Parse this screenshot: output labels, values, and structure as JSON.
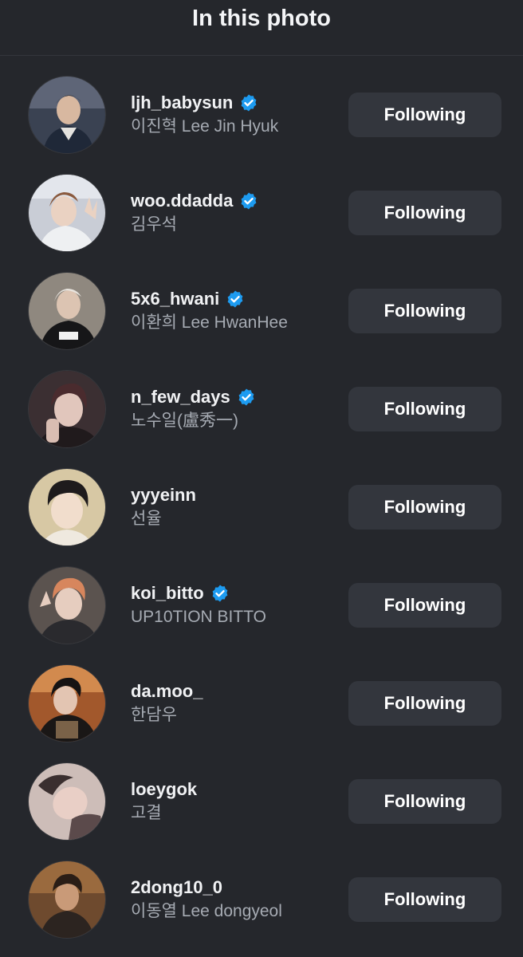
{
  "header": {
    "title": "In this photo"
  },
  "colors": {
    "background": "#25272c",
    "button": "#33363d",
    "verified": "#1d9bf0",
    "secondary_text": "#a6abb3"
  },
  "users": [
    {
      "username": "ljh_babysun",
      "verified": true,
      "full_name": "이진혁 Lee Jin Hyuk",
      "button_label": "Following"
    },
    {
      "username": "woo.ddadda",
      "verified": true,
      "full_name": "김우석",
      "button_label": "Following"
    },
    {
      "username": "5x6_hwani",
      "verified": true,
      "full_name": "이환희 Lee HwanHee",
      "button_label": "Following"
    },
    {
      "username": "n_few_days",
      "verified": true,
      "full_name": "노수일(盧秀一)",
      "button_label": "Following"
    },
    {
      "username": "yyyeinn",
      "verified": false,
      "full_name": "선율",
      "button_label": "Following"
    },
    {
      "username": "koi_bitto",
      "verified": true,
      "full_name": "UP10TION BITTO",
      "button_label": "Following"
    },
    {
      "username": "da.moo_",
      "verified": false,
      "full_name": "한담우",
      "button_label": "Following"
    },
    {
      "username": "loeygok",
      "verified": false,
      "full_name": "고결",
      "button_label": "Following"
    },
    {
      "username": "2dong10_0",
      "verified": false,
      "full_name": "이동열 Lee dongyeol",
      "button_label": "Following"
    }
  ]
}
